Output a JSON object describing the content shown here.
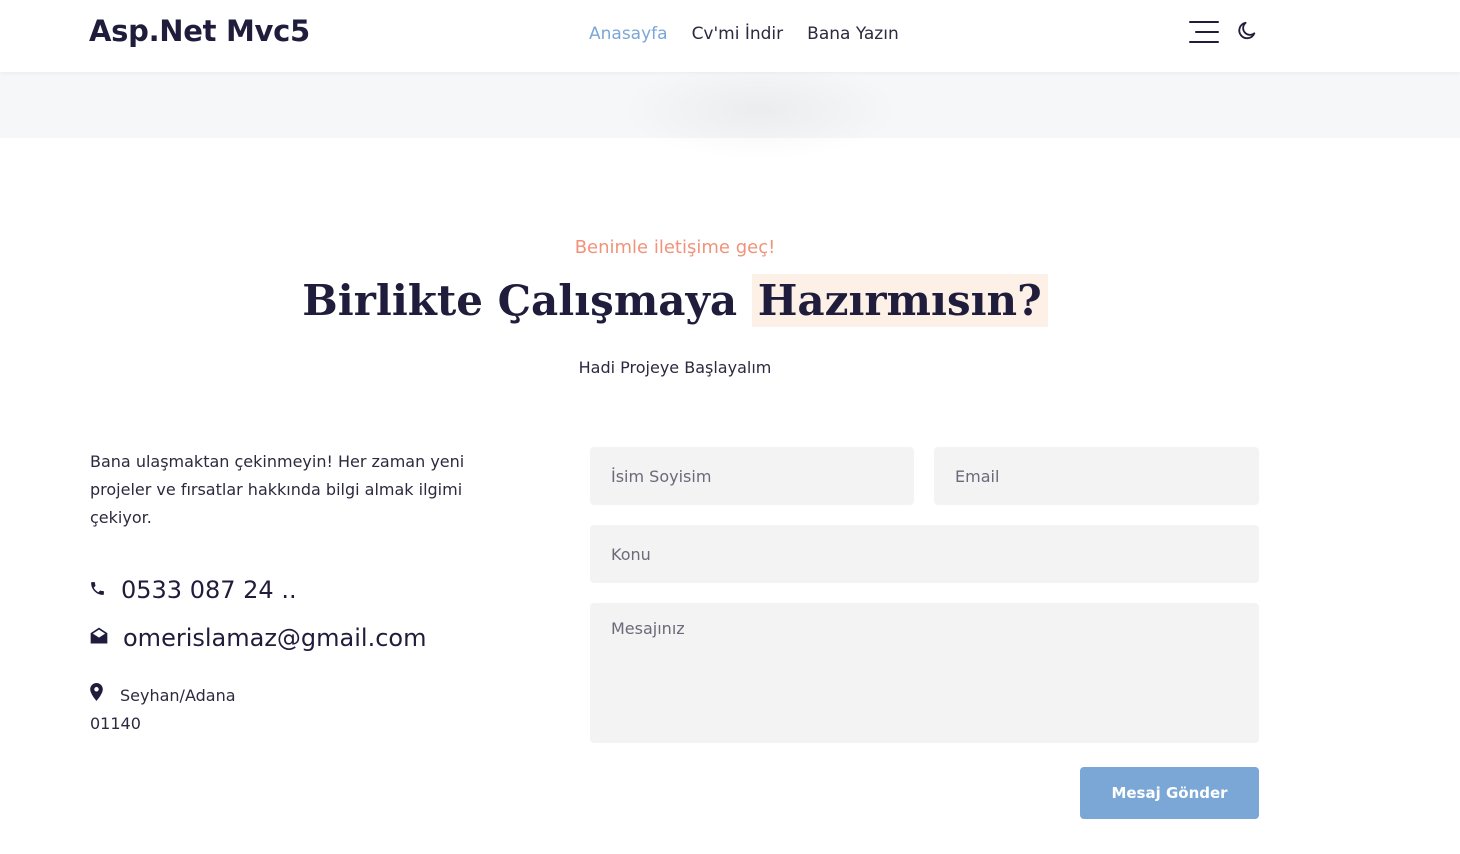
{
  "header": {
    "brand": "Asp.Net Mvc5",
    "nav": [
      {
        "label": "Anasayfa",
        "active": true
      },
      {
        "label": "Cv'mi İndir",
        "active": false
      },
      {
        "label": "Bana Yazın",
        "active": false
      }
    ],
    "icons": [
      "menu-icon",
      "moon-icon"
    ]
  },
  "contact": {
    "eyebrow": "Benimle iletişime geç!",
    "title_main": "Birlikte Çalışmaya",
    "title_highlight": "Hazırmısın?",
    "subtitle": "Hadi Projeye Başlayalım",
    "intro": "Bana ulaşmaktan çekinmeyin! Her zaman yeni projeler ve fırsatlar hakkında bilgi almak ilgimi çekiyor.",
    "phone": "0533 087 24 ..",
    "email": "omerislamaz@gmail.com",
    "address_line1": "Seyhan/Adana",
    "address_line2": "01140"
  },
  "form": {
    "name_placeholder": "İsim Soyisim",
    "email_placeholder": "Email",
    "subject_placeholder": "Konu",
    "message_placeholder": "Mesajınız",
    "submit_label": "Mesaj Gönder"
  },
  "colors": {
    "accent": "#7aa7d6",
    "eyebrow": "#f0937a",
    "highlight_bg": "#fdf0e6",
    "input_bg": "#f3f3f4",
    "text_dark": "#1f1d3b"
  }
}
